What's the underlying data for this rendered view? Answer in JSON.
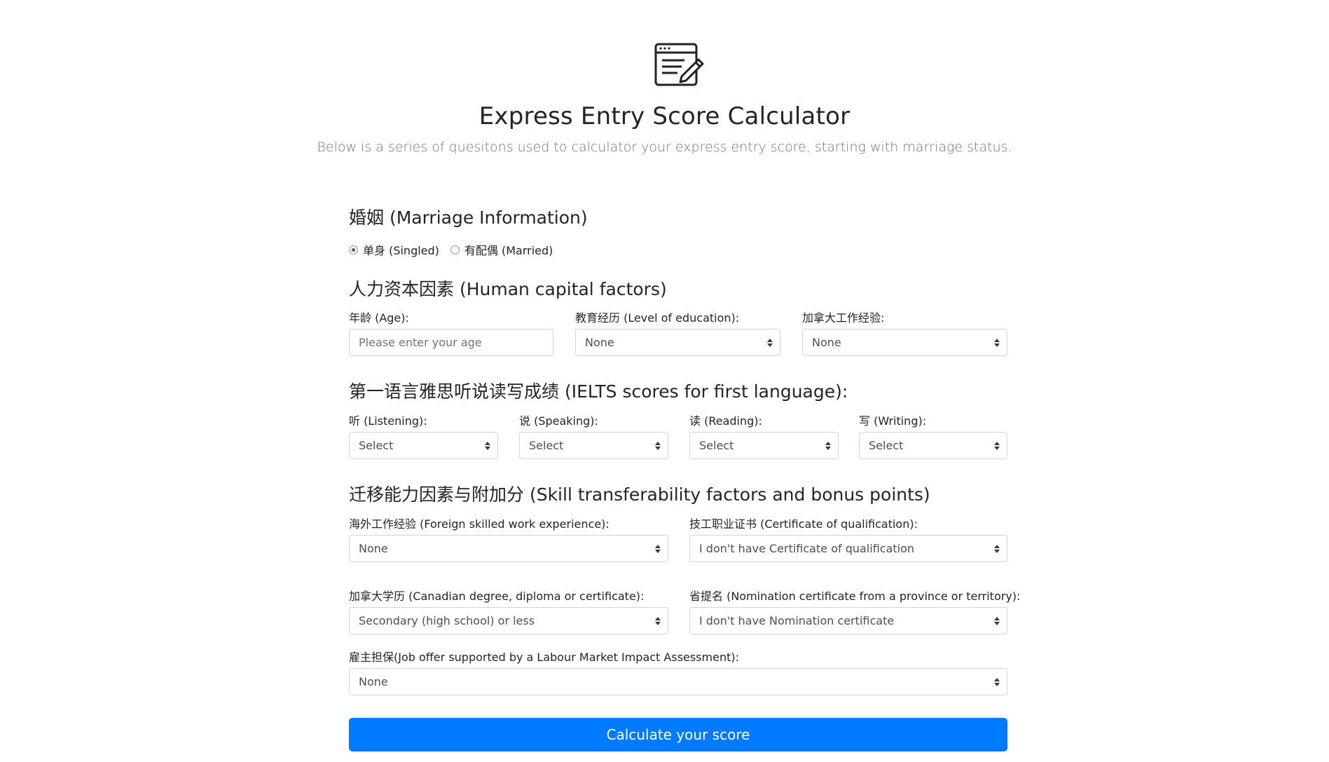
{
  "header": {
    "icon": "form-edit-icon",
    "title": "Express Entry Score Calculator",
    "subtitle": "Below is a series of quesitons used to calculator your express entry score, starting with marriage status."
  },
  "marriage": {
    "title": "婚姻 (Marriage Information)",
    "options": [
      {
        "label": "单身 (Singled)",
        "checked": true
      },
      {
        "label": "有配偶 (Married)",
        "checked": false
      }
    ]
  },
  "human_capital": {
    "title": "人力资本因素 (Human capital factors)",
    "age": {
      "label": "年龄 (Age):",
      "placeholder": "Please enter your age",
      "value": ""
    },
    "education": {
      "label": "教育经历 (Level of education):",
      "value": "None"
    },
    "canada_work": {
      "label": "加拿大工作经验:",
      "value": "None"
    }
  },
  "ielts": {
    "title": "第一语言雅思听说读写成绩 (IELTS scores for first language):",
    "listening": {
      "label": "听 (Listening):",
      "value": "Select"
    },
    "speaking": {
      "label": "说 (Speaking):",
      "value": "Select"
    },
    "reading": {
      "label": "读 (Reading):",
      "value": "Select"
    },
    "writing": {
      "label": "写 (Writing):",
      "value": "Select"
    }
  },
  "skill": {
    "title": "迁移能力因素与附加分 (Skill transferability factors and bonus points)",
    "foreign_work": {
      "label": "海外工作经验 (Foreign skilled work experience):",
      "value": "None"
    },
    "certificate": {
      "label": "技工职业证书 (Certificate of qualification):",
      "value": "I don't have Certificate of qualification"
    },
    "canadian_degree": {
      "label": "加拿大学历 (Canadian degree, diploma or certificate):",
      "value": "Secondary (high school) or less"
    },
    "nomination": {
      "label": "省提名 (Nomination certificate from a province or territory):",
      "value": "I don't have Nomination certificate"
    },
    "job_offer": {
      "label": "雇主担保(Job offer supported by a Labour Market Impact Assessment):",
      "value": "None"
    }
  },
  "submit": {
    "label": "Calculate your score",
    "color": "#007bff"
  }
}
